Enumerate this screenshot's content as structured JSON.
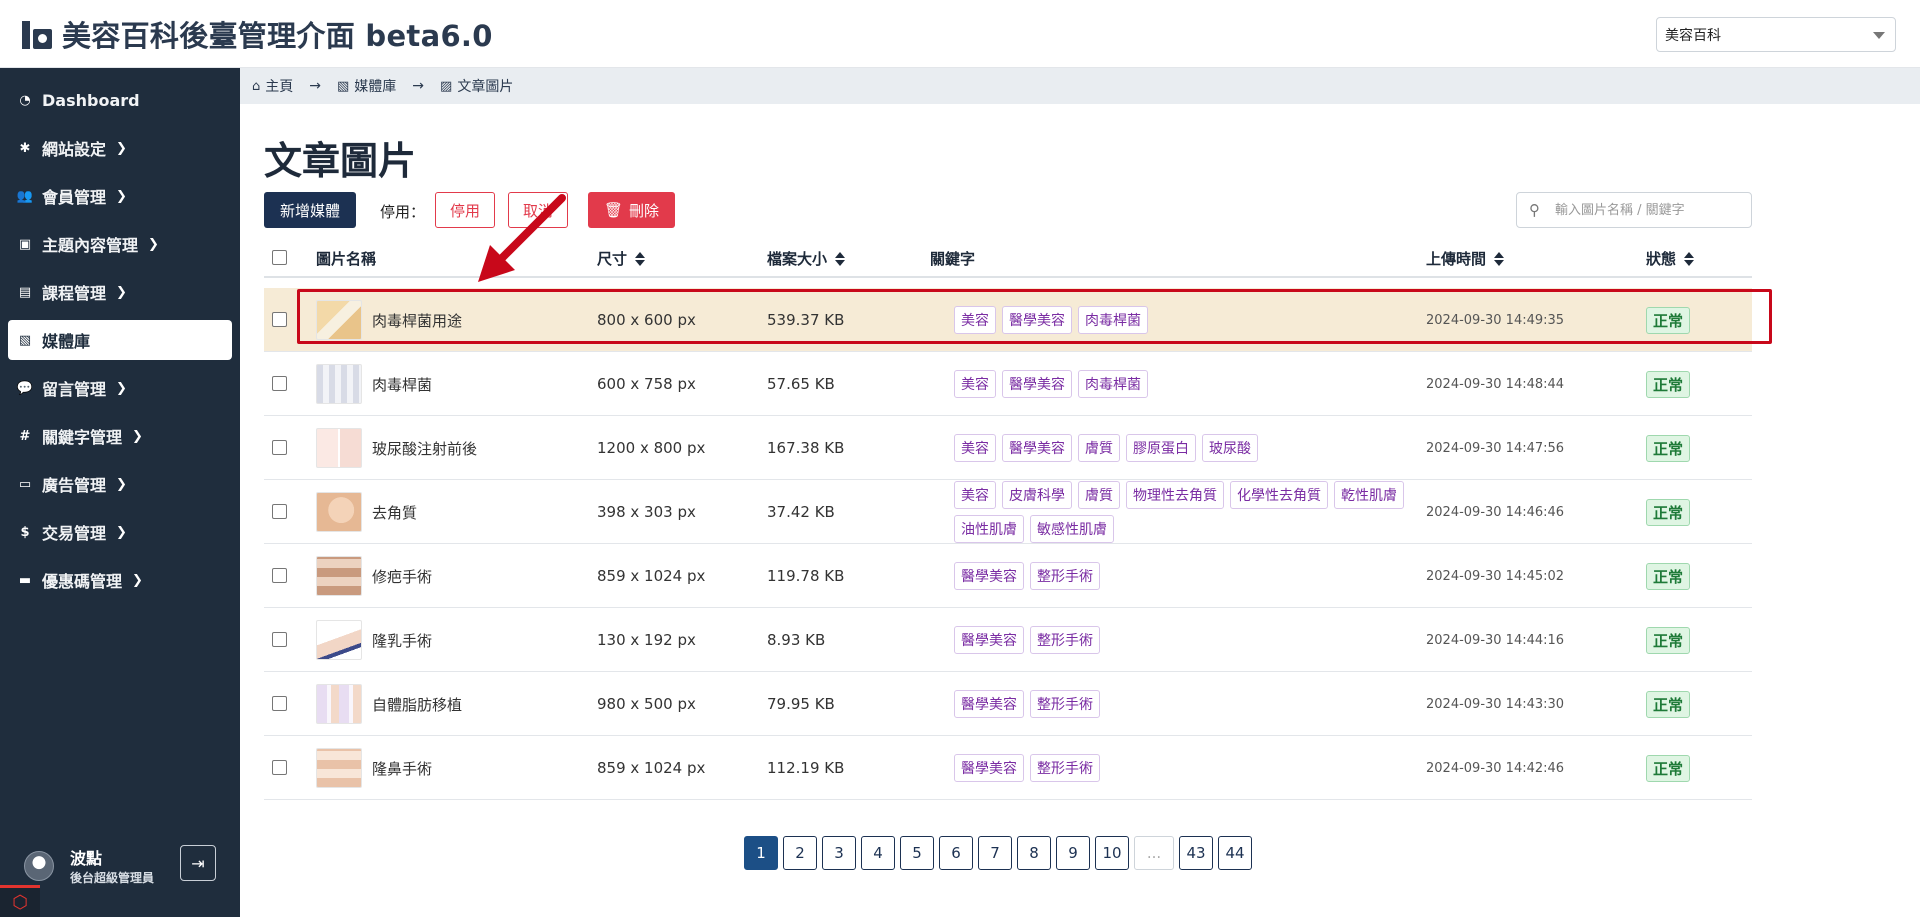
{
  "header": {
    "title": "美容百科後臺管理介面 beta6.0",
    "site_select_value": "美容百科"
  },
  "sidebar": {
    "items": [
      {
        "label": "Dashboard",
        "icon": "dashboard-icon",
        "has_children": false
      },
      {
        "label": "網站設定",
        "icon": "gear-icon",
        "has_children": true
      },
      {
        "label": "會員管理",
        "icon": "users-icon",
        "has_children": true
      },
      {
        "label": "主題內容管理",
        "icon": "book-icon",
        "has_children": true
      },
      {
        "label": "課程管理",
        "icon": "document-icon",
        "has_children": true
      },
      {
        "label": "媒體庫",
        "icon": "images-icon",
        "has_children": false,
        "active": true
      },
      {
        "label": "留言管理",
        "icon": "comment-icon",
        "has_children": true
      },
      {
        "label": "關鍵字管理",
        "icon": "hashtag-icon",
        "has_children": true
      },
      {
        "label": "廣告管理",
        "icon": "ad-icon",
        "has_children": true
      },
      {
        "label": "交易管理",
        "icon": "money-bag-icon",
        "has_children": true
      },
      {
        "label": "優惠碼管理",
        "icon": "ticket-icon",
        "has_children": true
      }
    ],
    "user": {
      "name": "波點",
      "role": "後台超級管理員"
    }
  },
  "breadcrumb": {
    "home": "主頁",
    "media": "媒體庫",
    "current": "文章圖片"
  },
  "page": {
    "title": "文章圖片",
    "add_button": "新增媒體",
    "disable_label": "停用：",
    "disable_button": "停用",
    "cancel_button": "取消",
    "delete_button": "刪除",
    "search_placeholder": "輸入圖片名稱 / 關鍵字"
  },
  "table": {
    "headers": {
      "name": "圖片名稱",
      "size": "尺寸",
      "file_size": "檔案大小",
      "keywords": "關鍵字",
      "upload_time": "上傳時間",
      "status": "狀態"
    },
    "rows": [
      {
        "name": "肉毒桿菌用途",
        "size": "800 x 600 px",
        "file_size": "539.37 KB",
        "tags": [
          "美容",
          "醫學美容",
          "肉毒桿菌"
        ],
        "time": "2024-09-30 14:49:35",
        "status": "正常",
        "highlighted": true
      },
      {
        "name": "肉毒桿菌",
        "size": "600 x 758 px",
        "file_size": "57.65 KB",
        "tags": [
          "美容",
          "醫學美容",
          "肉毒桿菌"
        ],
        "time": "2024-09-30 14:48:44",
        "status": "正常"
      },
      {
        "name": "玻尿酸注射前後",
        "size": "1200 x 800 px",
        "file_size": "167.38 KB",
        "tags": [
          "美容",
          "醫學美容",
          "膚質",
          "膠原蛋白",
          "玻尿酸"
        ],
        "time": "2024-09-30 14:47:56",
        "status": "正常"
      },
      {
        "name": "去角質",
        "size": "398 x 303 px",
        "file_size": "37.42 KB",
        "tags": [
          "美容",
          "皮膚科學",
          "膚質",
          "物理性去角質",
          "化學性去角質",
          "乾性肌膚",
          "油性肌膚",
          "敏感性肌膚"
        ],
        "time": "2024-09-30 14:46:46",
        "status": "正常"
      },
      {
        "name": "修疤手術",
        "size": "859 x 1024 px",
        "file_size": "119.78 KB",
        "tags": [
          "醫學美容",
          "整形手術"
        ],
        "time": "2024-09-30 14:45:02",
        "status": "正常"
      },
      {
        "name": "隆乳手術",
        "size": "130 x 192 px",
        "file_size": "8.93 KB",
        "tags": [
          "醫學美容",
          "整形手術"
        ],
        "time": "2024-09-30 14:44:16",
        "status": "正常"
      },
      {
        "name": "自體脂肪移植",
        "size": "980 x 500 px",
        "file_size": "79.95 KB",
        "tags": [
          "醫學美容",
          "整形手術"
        ],
        "time": "2024-09-30 14:43:30",
        "status": "正常"
      },
      {
        "name": "隆鼻手術",
        "size": "859 x 1024 px",
        "file_size": "112.19 KB",
        "tags": [
          "醫學美容",
          "整形手術"
        ],
        "time": "2024-09-30 14:42:46",
        "status": "正常"
      }
    ]
  },
  "pagination": {
    "pages": [
      "1",
      "2",
      "3",
      "4",
      "5",
      "6",
      "7",
      "8",
      "9",
      "10",
      "...",
      "43",
      "44"
    ],
    "current": "1"
  },
  "colors": {
    "sidebar_bg": "#1f2d3d",
    "primary": "#1c3152",
    "danger": "#e23a4b",
    "tag_text": "#7a2ca3",
    "status_green": "#1e7a38",
    "highlight_row": "#f6ebd6",
    "annotation_red": "#c8081a"
  }
}
